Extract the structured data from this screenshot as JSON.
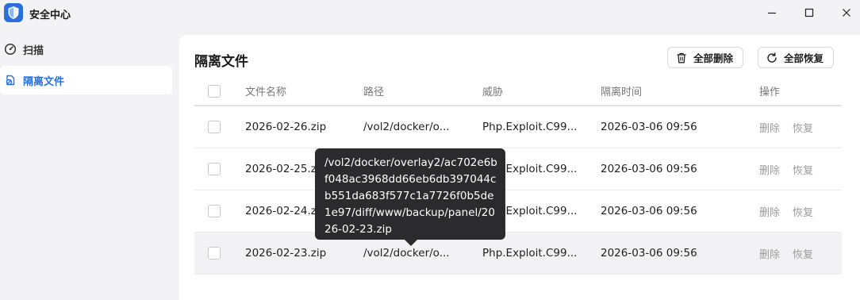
{
  "app": {
    "title": "安全中心",
    "accent": "#2a6fdb",
    "icon": "shield-icon"
  },
  "window_controls": [
    "minimize-icon",
    "maximize-icon",
    "close-icon"
  ],
  "sidebar": {
    "items": [
      {
        "label": "扫描",
        "icon": "scan-icon",
        "active": false
      },
      {
        "label": "隔离文件",
        "icon": "quarantine-icon",
        "active": true
      }
    ]
  },
  "main": {
    "title": "隔离文件",
    "delete_all_label": "全部删除",
    "restore_all_label": "全部恢复",
    "columns": [
      "文件名称",
      "路径",
      "威胁",
      "隔离时间",
      "操作"
    ],
    "rows": [
      {
        "name": "2026-02-26.zip",
        "path": "/vol2/docker/o...",
        "threat": "Php.Exploit.C99...",
        "time": "2026-03-06 09:56",
        "delete": "删除",
        "restore": "恢复"
      },
      {
        "name": "2026-02-25.z",
        "path": "",
        "threat": "Php.Exploit.C99...",
        "time": "2026-03-06 09:56",
        "delete": "删除",
        "restore": "恢复"
      },
      {
        "name": "2026-02-24.z",
        "path": "",
        "threat": "Php.Exploit.C99...",
        "time": "2026-03-06 09:56",
        "delete": "删除",
        "restore": "恢复"
      },
      {
        "name": "2026-02-23.zip",
        "path": "/vol2/docker/o...",
        "threat": "Php.Exploit.C99...",
        "time": "2026-03-06 09:56",
        "delete": "删除",
        "restore": "恢复"
      }
    ]
  },
  "tooltip": {
    "text": "/vol2/docker/overlay2/ac702e6bf048ac3968dd66eb6db397044cb551da683f577c1a7726f0b5de1e97/diff/www/backup/panel/2026-02-23.zip"
  }
}
